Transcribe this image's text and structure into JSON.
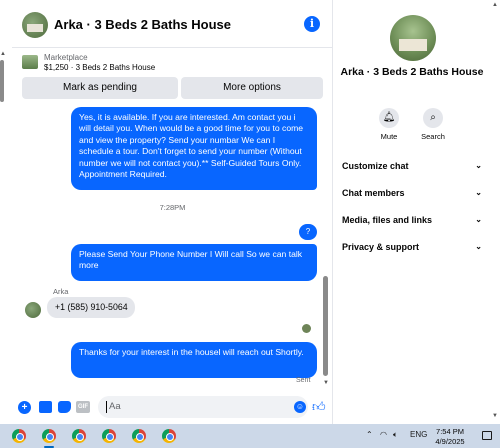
{
  "header": {
    "title": "Arka · 3 Beds 2 Baths House",
    "info_icon": "i"
  },
  "marketplace": {
    "label": "Marketplace",
    "listing": "$1,250 · 3 Beds 2 Baths House",
    "mark_pending_label": "Mark as pending",
    "more_options_label": "More options"
  },
  "messages": {
    "outgoing_1": "Yes, it is available. If you are interested.  Am contact you i will detail you.  When would be a good time for you to come and view the property? Send your numbar We can I schedule a tour.  Don't forget to send your number (Without number we will not contact you).** Self-Guided Tours Only. Appointment Required.",
    "timestamp": "7:28PM",
    "outgoing_q": "?",
    "outgoing_2": "Please Send Your Phone Number I Will call So we can talk more",
    "incoming_name": "Arka",
    "incoming_1": "+1 (585) 910-5064",
    "outgoing_3": "Thanks for your interest in the housel will reach out Shortly.",
    "status": "Sent"
  },
  "composer": {
    "placeholder": "Aa",
    "gif_label": "GIF"
  },
  "sidebar": {
    "title": "Arka · 3 Beds 2 Baths House",
    "mute_label": "Mute",
    "search_label": "Search",
    "sections": [
      {
        "label": "Customize chat"
      },
      {
        "label": "Chat members"
      },
      {
        "label": "Media, files and links"
      },
      {
        "label": "Privacy & support"
      }
    ]
  },
  "taskbar": {
    "language": "ENG",
    "time": "7:54 PM",
    "date": "4/9/2025"
  },
  "colors": {
    "accent": "#0866ff",
    "bubble_in": "#e4e6eb",
    "taskbar": "#ccd8e8"
  }
}
